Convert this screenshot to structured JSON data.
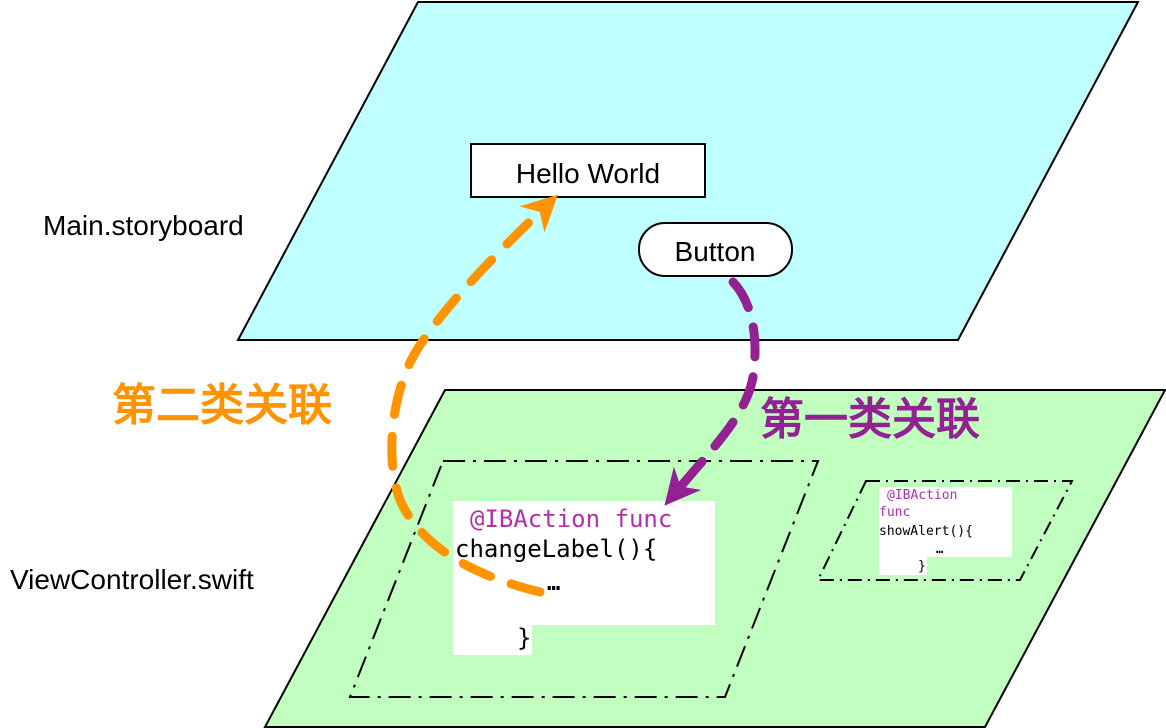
{
  "layers": {
    "storyboard": {
      "label": "Main.storyboard",
      "color": "#c0ffff"
    },
    "controller": {
      "label": "ViewController.swift",
      "color": "#c0ffc0"
    }
  },
  "storyboard_items": {
    "label_text": "Hello World",
    "button_text": "Button"
  },
  "code_blocks": [
    {
      "line1": "@IBAction func",
      "line2": "changeLabel(){",
      "ellipsis": "…",
      "close": "}"
    },
    {
      "line1": "@IBAction",
      "line1b": "func",
      "line2": "showAlert(){",
      "ellipsis": "…",
      "close": "}"
    }
  ],
  "connections": {
    "first": {
      "label": "第一类关联",
      "color": "#942192"
    },
    "second": {
      "label": "第二类关联",
      "color": "#ff9300"
    }
  },
  "colors": {
    "keyword": "#b22fa8",
    "text": "#000000"
  }
}
